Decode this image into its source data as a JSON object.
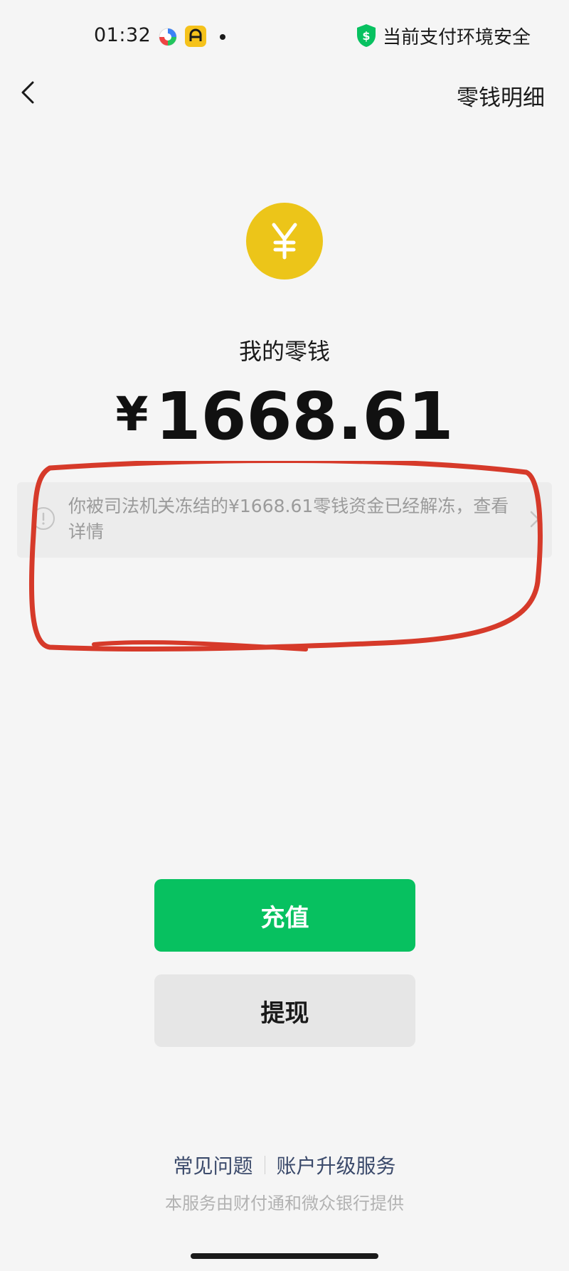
{
  "status_bar": {
    "time": "01:32",
    "security_text": "当前支付环境安全",
    "icons": [
      "app-icon",
      "app-icon",
      "notification-dot-icon",
      "shield-dollar-icon"
    ]
  },
  "nav": {
    "back_icon": "chevron-left-icon",
    "link_label": "零钱明细"
  },
  "balance": {
    "coin_icon": "yen-coin-icon",
    "label": "我的零钱",
    "currency_symbol": "¥",
    "amount": "1668.61"
  },
  "notice": {
    "icon": "info-circle-icon",
    "text": "你被司法机关冻结的¥1668.61零钱资金已经解冻，查看详情",
    "chevron": "chevron-right-icon"
  },
  "buttons": {
    "recharge_label": "充值",
    "withdraw_label": "提现"
  },
  "footer": {
    "faq_label": "常见问题",
    "upgrade_label": "账户升级服务",
    "provider_text": "本服务由财付通和微众银行提供"
  },
  "colors": {
    "primary_green": "#07c160",
    "coin_yellow": "#ecc519",
    "annotation_red": "#d63a2a",
    "background": "#f5f5f5"
  }
}
